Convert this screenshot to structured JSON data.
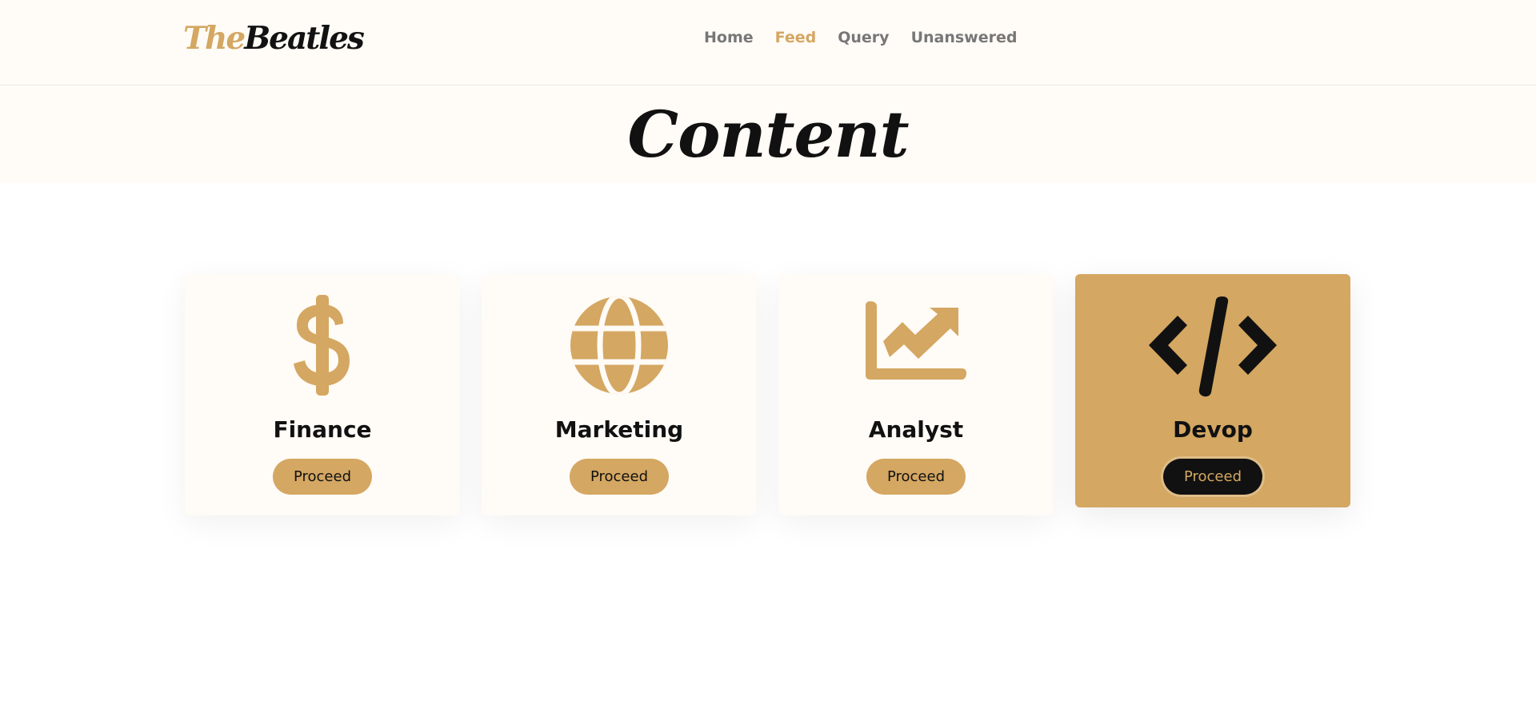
{
  "logo": {
    "part1": "The",
    "part2": "Beatles"
  },
  "nav": {
    "items": [
      {
        "label": "Home"
      },
      {
        "label": "Feed"
      },
      {
        "label": "Query"
      },
      {
        "label": "Unanswered"
      }
    ],
    "active": "Feed"
  },
  "banner": {
    "title": "Content"
  },
  "cards": [
    {
      "title": "Finance",
      "icon": "dollar-icon",
      "button": "Proceed"
    },
    {
      "title": "Marketing",
      "icon": "globe-icon",
      "button": "Proceed"
    },
    {
      "title": "Analyst",
      "icon": "chart-trend-icon",
      "button": "Proceed"
    },
    {
      "title": "Devop",
      "icon": "code-icon",
      "button": "Proceed"
    }
  ],
  "colors": {
    "accent": "#d4a762",
    "dark": "#111111",
    "background": "#fffbf6",
    "nav_text": "#777777"
  }
}
